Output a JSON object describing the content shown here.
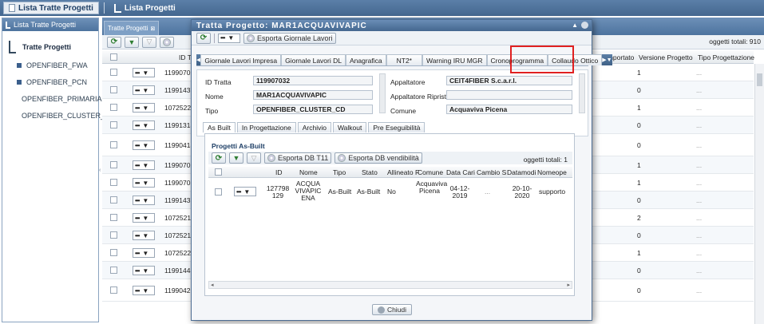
{
  "topbar": {
    "tabs": [
      "Lista Tratte Progetti",
      "Lista Progetti"
    ]
  },
  "left_panel": {
    "header": "Lista Tratte Progetti",
    "root": "Tratte Progetti",
    "items": [
      "OPENFIBER_FWA",
      "OPENFIBER_PCN",
      "OPENFIBER_PRIMARIA",
      "OPENFIBER_CLUSTER_"
    ]
  },
  "main": {
    "tab": "Tratte Progetti",
    "totals": "oggetti totali: 910",
    "columns": [
      "ID T",
      "2° Importato",
      "Versione Progetto",
      "Tipo Progettazione"
    ],
    "rows": [
      {
        "id": "11990702",
        "versione": "1",
        "tipo": "..."
      },
      {
        "id": "11991437",
        "versione": "0",
        "tipo": "..."
      },
      {
        "id": "10725225",
        "versione": "1",
        "tipo": "..."
      },
      {
        "id": "11991318",
        "versione": "0",
        "tipo": "..."
      },
      {
        "id": "11990418",
        "versione": "0",
        "tipo": "..."
      },
      {
        "id": "11990702",
        "versione": "1",
        "tipo": "..."
      },
      {
        "id": "11990703",
        "versione": "1",
        "tipo": "..."
      },
      {
        "id": "11991437",
        "versione": "0",
        "tipo": "..."
      },
      {
        "id": "10725215",
        "versione": "2",
        "tipo": "..."
      },
      {
        "id": "10725215",
        "versione": "0",
        "tipo": "..."
      },
      {
        "id": "10725225",
        "versione": "1",
        "tipo": "..."
      },
      {
        "id": "11991443",
        "versione": "0",
        "tipo": "..."
      },
      {
        "id": "11990426",
        "versione": "0",
        "tipo": "..."
      }
    ]
  },
  "modal": {
    "title": "Tratta Progetto: MAR1ACQUAVIVAPIC",
    "export_button": "Esporta Giornale Lavori",
    "tabs": [
      "Giornale Lavori Impresa",
      "Giornale Lavori DL",
      "Anagrafica",
      "NT2*",
      "Warning IRU MGR",
      "Cronoprogramma",
      "Collaudo Ottico"
    ],
    "form": {
      "id_tratta_label": "ID Tratta",
      "id_tratta": "119907032",
      "nome_label": "Nome",
      "nome": "MAR1ACQUAVIVAPIC",
      "tipo_label": "Tipo",
      "tipo": "OPENFIBER_CLUSTER_CD",
      "appaltatore_label": "Appaltatore",
      "appaltatore": "CEIT4FIBER S.c.a.r.l.",
      "appaltatore_ripristini_label": "Appaltatore Ripristini",
      "appaltatore_ripristini": "",
      "comune_label": "Comune",
      "comune": "Acquaviva Picena"
    },
    "subtabs": [
      "As Built",
      "In Progettazione",
      "Archivio",
      "Walkout",
      "Pre Eseguibilità"
    ],
    "asbuilt": {
      "title": "Progetti As-Built",
      "export_t11": "Esporta DB T11",
      "export_vendibilita": "Esporta DB vendibilità",
      "totals": "oggetti totali: 1",
      "columns": [
        "ID",
        "Nome",
        "Tipo",
        "Stato",
        "Allineato F",
        "Comune",
        "Data Cari",
        "Cambio S",
        "Datamodi",
        "Nomeope"
      ],
      "row": {
        "id": "127798129",
        "nome": "ACQUAVIVAPICENA",
        "tipo": "As-Built",
        "stato": "As-Built",
        "allineato": "No",
        "comune": "Acquaviva Picena",
        "data_cari": "04-12-2019",
        "cambio": "...",
        "datamodi": "20-10-2020",
        "nomeope": "supporto"
      }
    },
    "close_button": "Chiudi"
  }
}
